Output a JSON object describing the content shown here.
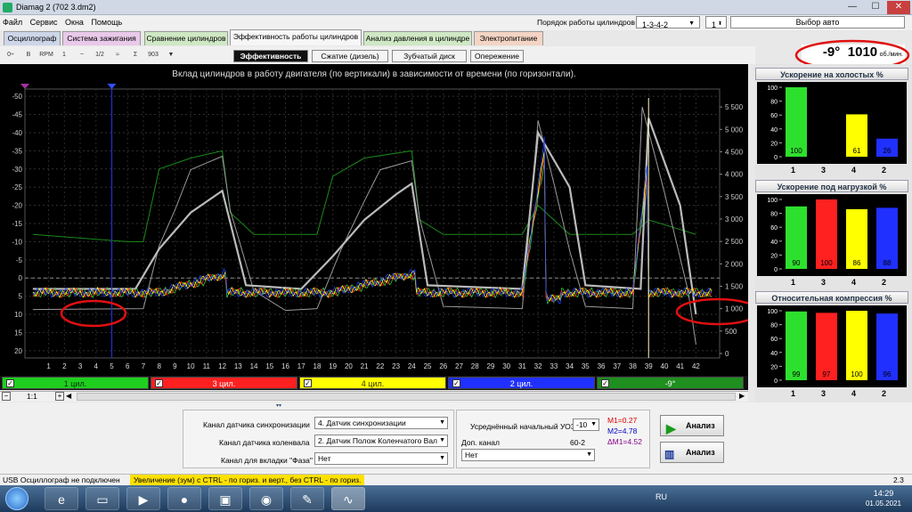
{
  "window": {
    "title": "Diamag 2 (702 3.dm2)",
    "min": "—",
    "max": "☐",
    "close": "✕"
  },
  "menu": [
    "Файл",
    "Сервис",
    "Окна",
    "Помощь"
  ],
  "topbar": {
    "order_label": "Порядок работы цилиндров",
    "order_value": "1-3-4-2",
    "cyl_value": "1",
    "auto_select": "Выбор авто"
  },
  "tabs": [
    {
      "label": "Осциллограф",
      "color": "#cdd6e8"
    },
    {
      "label": "Система зажигания",
      "color": "#e9c9e9"
    },
    {
      "label": "Сравнение цилиндров",
      "color": "#cfe8c4"
    },
    {
      "label": "Эффективность работы цилиндров",
      "color": "#f6f6f6"
    },
    {
      "label": "Анализ давления в цилиндре",
      "color": "#cfe8c4"
    },
    {
      "label": "Электропитание",
      "color": "#f4d4c4"
    }
  ],
  "subtabs": [
    "Эффективность",
    "Сжатие (дизель)",
    "Зубчатый диск",
    "Опережение"
  ],
  "toolbar_icons": [
    "scale-icon",
    "trigger-b-icon",
    "rpm-icon",
    "cursor-icon",
    "curve-icon",
    "fraction-icon",
    "wave-icon",
    "filter-icon",
    "number-icon",
    "flag-icon"
  ],
  "toolbar_labels": [
    "0÷",
    "B",
    "RPM",
    "1",
    "~",
    "1/2",
    "≈",
    "Σ",
    "903",
    "▼"
  ],
  "readout": {
    "angle": "-9°",
    "rpm": "1010",
    "unit": "об./мин."
  },
  "chart_data": {
    "type": "line",
    "title": "Вклад цилиндров в работу двигателя (по вертикали) в зависимости от времени (по горизонтали).",
    "y_left_ticks": [
      "-50",
      "-45",
      "-40",
      "-35",
      "-30",
      "-25",
      "-20",
      "-15",
      "-10",
      "-5",
      "0",
      "5",
      "10",
      "15",
      "20"
    ],
    "y_right_ticks": [
      "5 500",
      "5 000",
      "4 500",
      "4 000",
      "3 500",
      "3 000",
      "2 500",
      "2 000",
      "1 500",
      "1 000",
      "500",
      "0"
    ],
    "x_ticks": [
      "1",
      "2",
      "3",
      "4",
      "5",
      "6",
      "7",
      "8",
      "9",
      "10",
      "11",
      "12",
      "13",
      "14",
      "15",
      "16",
      "17",
      "18",
      "19",
      "20",
      "21",
      "22",
      "23",
      "24",
      "25",
      "26",
      "27",
      "28",
      "29",
      "30",
      "31",
      "32",
      "33",
      "34",
      "35",
      "36",
      "37",
      "38",
      "39",
      "40",
      "41",
      "42"
    ],
    "series": [
      {
        "name": "1 цил.",
        "color": "#2ecc40"
      },
      {
        "name": "3 цил.",
        "color": "#ff2020"
      },
      {
        "name": "4 цил.",
        "color": "#ffff00"
      },
      {
        "name": "2 цил.",
        "color": "#2040ff"
      },
      {
        "name": "-9°",
        "color": "#1a8a1a"
      }
    ],
    "grid": true,
    "rpm_trace": [
      [
        0,
        980
      ],
      [
        7,
        1000
      ],
      [
        8,
        2400
      ],
      [
        9,
        3200
      ],
      [
        10,
        4100
      ],
      [
        12,
        4400
      ],
      [
        12.5,
        3200
      ],
      [
        14,
        1400
      ],
      [
        16,
        960
      ],
      [
        18,
        1000
      ],
      [
        19.5,
        2300
      ],
      [
        21,
        3400
      ],
      [
        22,
        4100
      ],
      [
        24,
        4300
      ],
      [
        24.5,
        3000
      ],
      [
        26,
        1050
      ],
      [
        31,
        1000
      ],
      [
        32,
        5200
      ],
      [
        33,
        3800
      ],
      [
        34,
        2300
      ],
      [
        35,
        1050
      ],
      [
        38,
        1000
      ],
      [
        38.6,
        5500
      ],
      [
        40,
        3600
      ],
      [
        41.5,
        1400
      ],
      [
        42,
        200
      ]
    ],
    "gray_trace": [
      [
        0,
        3
      ],
      [
        6.5,
        3
      ],
      [
        8,
        -8
      ],
      [
        10,
        -18
      ],
      [
        11,
        -21
      ],
      [
        12,
        -24
      ],
      [
        13.5,
        2
      ],
      [
        17,
        3
      ],
      [
        19,
        -6
      ],
      [
        21,
        -16
      ],
      [
        23,
        -23
      ],
      [
        24,
        -26
      ],
      [
        25,
        2
      ],
      [
        31,
        3
      ],
      [
        32,
        -40
      ],
      [
        34,
        -25
      ],
      [
        35,
        2
      ],
      [
        38.5,
        3
      ],
      [
        39,
        -44
      ],
      [
        41,
        -20
      ],
      [
        42,
        10
      ]
    ],
    "green_trace": [
      [
        0,
        -12
      ],
      [
        6,
        -10
      ],
      [
        7,
        -10
      ],
      [
        8,
        -30
      ],
      [
        10,
        -33
      ],
      [
        12,
        -35
      ],
      [
        12.5,
        -18
      ],
      [
        14,
        -12
      ],
      [
        18,
        -12
      ],
      [
        19,
        -28
      ],
      [
        21,
        -33
      ],
      [
        24,
        -35
      ],
      [
        24.5,
        -16
      ],
      [
        26,
        -12
      ],
      [
        31,
        -12
      ],
      [
        32,
        -20
      ],
      [
        34,
        -12
      ],
      [
        38,
        -12
      ],
      [
        39,
        -16
      ],
      [
        42,
        -12
      ]
    ]
  },
  "legend": [
    {
      "label": "1 цил.",
      "bg": "#1fcf1f",
      "fg": "#003300"
    },
    {
      "label": "3 цил.",
      "bg": "#ff2020",
      "fg": "#ffffff"
    },
    {
      "label": "4 цил.",
      "bg": "#ffff00",
      "fg": "#333300"
    },
    {
      "label": "2 цил.",
      "bg": "#2030ff",
      "fg": "#ffffff"
    },
    {
      "label": "-9°",
      "bg": "#1f8f1f",
      "fg": "#ffffff"
    }
  ],
  "zoom": {
    "label": "1:1"
  },
  "panels": [
    {
      "title": "Ускорение на холостых %",
      "values": [
        100,
        0,
        61,
        26
      ],
      "labels": [
        "100",
        "",
        "61",
        "26"
      ],
      "cyl": [
        "1",
        "3",
        "4",
        "2"
      ],
      "colors": [
        "#2ee02e",
        "#ff2020",
        "#ffff00",
        "#2030ff"
      ]
    },
    {
      "title": "Ускорение под нагрузкой %",
      "values": [
        90,
        100,
        86,
        88
      ],
      "labels": [
        "90",
        "100",
        "86",
        "88"
      ],
      "cyl": [
        "1",
        "3",
        "4",
        "2"
      ],
      "colors": [
        "#2ee02e",
        "#ff2020",
        "#ffff00",
        "#2030ff"
      ]
    },
    {
      "title": "Относительная компрессия %",
      "values": [
        99,
        97,
        100,
        96
      ],
      "labels": [
        "99",
        "97",
        "100",
        "96"
      ],
      "cyl": [
        "1",
        "3",
        "4",
        "2"
      ],
      "colors": [
        "#2ee02e",
        "#ff2020",
        "#ffff00",
        "#2030ff"
      ]
    }
  ],
  "panel_y_ticks": [
    "100",
    "80",
    "60",
    "40",
    "20",
    "0"
  ],
  "bottom": {
    "sync_label": "Канал датчика синхронизации",
    "sync_value": "4. Датчик синхронизации",
    "crank_label": "Канал датчика коленвала",
    "crank_value": "2. Датчик Полож Коленчатого Вал",
    "phase_label": "Канал для вкладки \"Фаза\"",
    "phase_value": "Нет",
    "uoz_label": "Усреднённый начальный УОЗ",
    "uoz_value": "-10",
    "extra_label": "Доп. канал",
    "extra_value": "Нет",
    "teeth": "60-2",
    "m1": "M1=0.27",
    "m2": "M2=4.78",
    "dm": "ΔM1=4.52",
    "btn1": "Анализ",
    "btn2": "Анализ"
  },
  "status": {
    "left": "USB Осциллограф не подключен",
    "hint": "Увеличение (зум) с CTRL - по гориз. и верт., без CTRL - по гориз.",
    "version": "2.3"
  },
  "taskbar": {
    "lang": "RU",
    "time": "14:29",
    "date": "01.05.2021"
  }
}
